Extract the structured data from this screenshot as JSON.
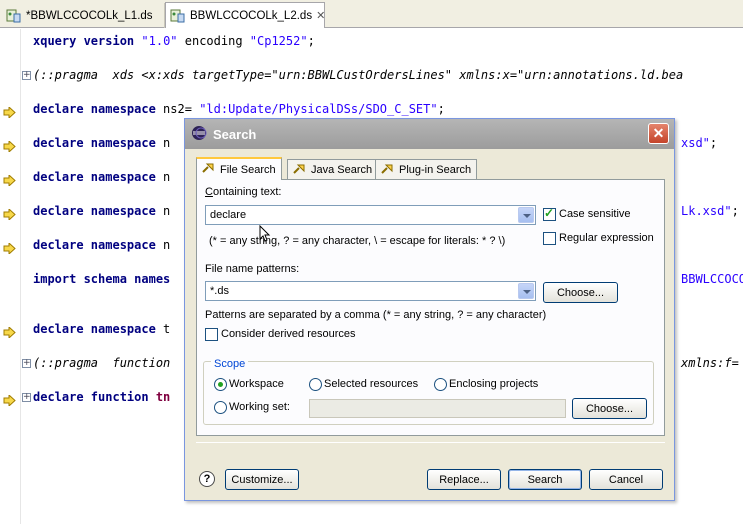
{
  "editor_tabs": [
    {
      "label": "*BBWLCCOCOLk_L1.ds",
      "active": false
    },
    {
      "label": "BBWLCCOCOLk_L2.ds",
      "active": true
    }
  ],
  "code_lines": [
    {
      "parts": [
        [
          "kw",
          "xquery version"
        ],
        [
          "txt",
          " "
        ],
        [
          "str",
          "\"1.0\""
        ],
        [
          "txt",
          " encoding "
        ],
        [
          "str",
          "\"Cp1252\""
        ],
        [
          "txt",
          ";"
        ]
      ]
    },
    {
      "parts": [
        [
          "cmt",
          "(::pragma  xds <x:xds targetType=\"urn:BBWLCustOrdersLines\" xmlns:x=\"urn:annotations.ld.bea"
        ]
      ]
    },
    {
      "parts": [
        [
          "kw",
          "declare namespace"
        ],
        [
          "txt",
          " ns2= "
        ],
        [
          "str",
          "\"ld:Update/PhysicalDSs/SDO_C_SET\""
        ],
        [
          "txt",
          ";"
        ]
      ]
    },
    {
      "parts": [
        [
          "kw",
          "declare namespace"
        ],
        [
          "txt",
          " n"
        ]
      ],
      "tail": [
        [
          "str",
          "xsd\""
        ],
        [
          "txt",
          ";"
        ]
      ]
    },
    {
      "parts": [
        [
          "kw",
          "declare namespace"
        ],
        [
          "txt",
          " n"
        ]
      ]
    },
    {
      "parts": [
        [
          "kw",
          "declare namespace"
        ],
        [
          "txt",
          " n"
        ]
      ],
      "tail": [
        [
          "str",
          "Lk.xsd\""
        ],
        [
          "txt",
          ";"
        ]
      ]
    },
    {
      "parts": [
        [
          "kw",
          "declare namespace"
        ],
        [
          "txt",
          " n"
        ]
      ]
    },
    {
      "parts": [
        [
          "kw",
          "import schema names"
        ]
      ],
      "tail": [
        [
          "str",
          "BBWLCCOCOL"
        ]
      ]
    },
    {
      "parts": [
        [
          "kw",
          "declare namespace"
        ],
        [
          "txt",
          " t"
        ]
      ]
    },
    {
      "parts": [
        [
          "cmt",
          "(::pragma  function"
        ]
      ],
      "tail": [
        [
          "cmt",
          "xmlns:f="
        ]
      ]
    },
    {
      "parts": [
        [
          "kw",
          "declare function"
        ],
        [
          "txt",
          " "
        ],
        [
          "fn",
          "tn"
        ]
      ]
    }
  ],
  "dialog": {
    "title": "Search",
    "close_glyph": "✕",
    "tabs": [
      {
        "label": "File Search",
        "selected": true
      },
      {
        "label": "Java Search",
        "selected": false
      },
      {
        "label": "Plug-in Search",
        "selected": false
      }
    ],
    "containing_text_label_pre": "C",
    "containing_text_label_rest": "ontaining text:",
    "containing_text_value": "declare",
    "containing_hint": "(* = any string, ? = any character, \\ = escape for literals: * ? \\)",
    "case_sensitive_label": "Case sensitive",
    "case_sensitive": true,
    "regex_label": "Regular expression",
    "regex": false,
    "file_name_patterns_label": "File name patterns:",
    "file_name_patterns_value": "*.ds",
    "choose_label": "Choose...",
    "patterns_hint": "Patterns are separated by a comma (* = any string, ? = any character)",
    "consider_derived_label": "Consider derived resources",
    "consider_derived": false,
    "scope_label": "Scope",
    "scope_options": [
      {
        "label": "Workspace",
        "selected": true
      },
      {
        "label": "Selected resources",
        "selected": false
      },
      {
        "label": "Enclosing projects",
        "selected": false
      },
      {
        "label": "Working set:",
        "selected": false
      }
    ],
    "working_set_value": "",
    "working_set_choose_label": "Choose...",
    "help_glyph": "?",
    "customize_label": "Customize...",
    "replace_label": "Replace...",
    "search_label": "Search",
    "cancel_label": "Cancel"
  },
  "colors": {
    "keyword": "#000080",
    "string": "#2a00ff",
    "function_name": "#800040",
    "dialog_bg": "#ece9d8",
    "titlebar": "#a9a9a9",
    "close_button": "#c4442a",
    "checkbox_green": "#21a121"
  }
}
